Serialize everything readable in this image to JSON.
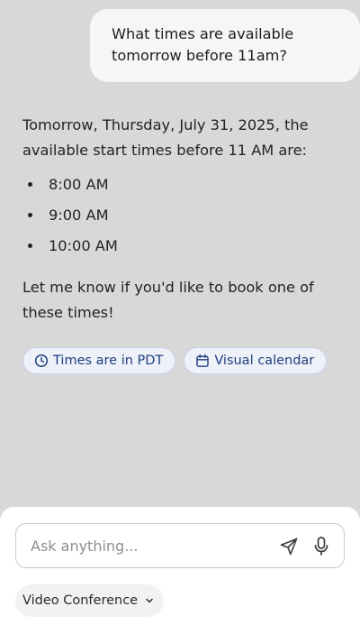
{
  "user_message": {
    "text": "What times are available tomorrow before 11am?"
  },
  "assistant_message": {
    "intro": "Tomorrow, Thursday, July 31, 2025, the available start times before 11 AM are:",
    "times": [
      "8:00 AM",
      "9:00 AM",
      "10:00 AM"
    ],
    "outro": "Let me know if you'd like to book one of these times!"
  },
  "chips": {
    "timezone_label": "Times are in PDT",
    "timezone_icon": "clock-icon",
    "calendar_label": "Visual calendar",
    "calendar_icon": "calendar-icon"
  },
  "composer": {
    "placeholder": "Ask anything...",
    "send_icon": "send-icon",
    "mic_icon": "microphone-icon",
    "mode_label": "Video Conference",
    "mode_icon": "chevron-down-icon"
  },
  "colors": {
    "background": "#d9d7d8",
    "chip_bg": "#eef1f8",
    "chip_border": "#c7d1ea",
    "chip_text": "#1f3f7d",
    "user_bubble": "#f6f6f7"
  }
}
